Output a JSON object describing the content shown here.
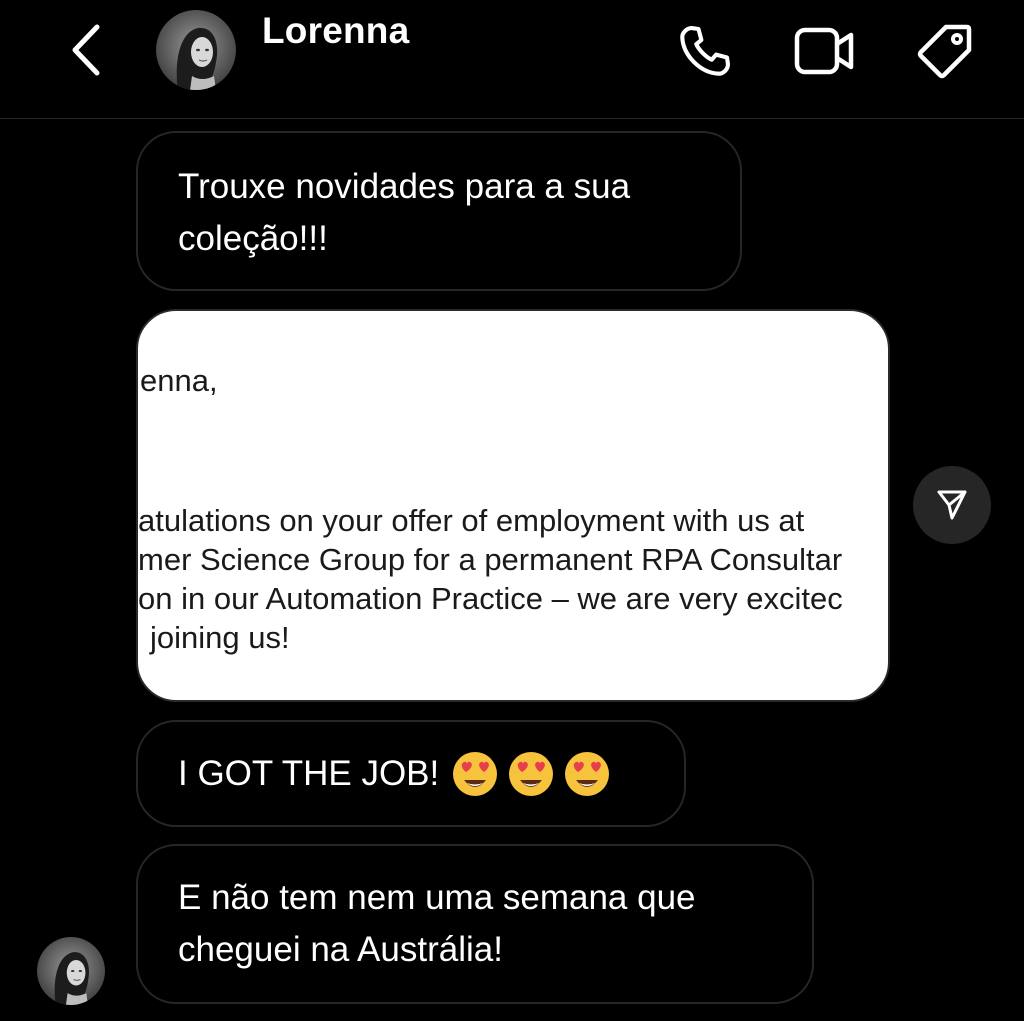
{
  "header": {
    "contact_name": "Lorenna"
  },
  "messages": [
    {
      "text": "Trouxe novidades para a sua coleção!!!"
    },
    {
      "type": "image",
      "document": {
        "greeting": "enna,",
        "lines": [
          "atulations on your offer of employment with us at",
          "mer Science Group for a permanent RPA Consultar",
          "on in our Automation Practice – we are very excitec",
          "joining us!"
        ]
      }
    },
    {
      "text": "I GOT THE JOB!",
      "emojis": [
        "heart-eyes",
        "heart-eyes",
        "heart-eyes"
      ]
    },
    {
      "text": "E não tem nem uma semana que cheguei na Austrália!"
    }
  ],
  "colors": {
    "background": "#000000",
    "bubble_border": "#262626",
    "text": "#ffffff",
    "share_button_bg": "#262626"
  }
}
